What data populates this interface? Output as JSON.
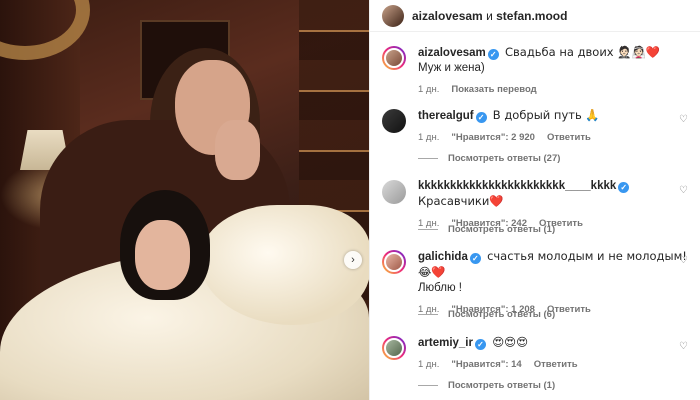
{
  "header": {
    "user1": "aizalovesam",
    "and": "и",
    "user2": "stefan.mood"
  },
  "caption": {
    "username": "aizalovesam",
    "text_line1": "Свадьба на двоих 🤵🏻👰🏻❤️",
    "text_line2": "Муж и жена)",
    "time": "1 дн.",
    "translate": "Показать перевод"
  },
  "comments": [
    {
      "username": "therealguf",
      "text": "В добрый путь 🙏",
      "time": "1 дн.",
      "likes": "\"Нравится\": 2 920",
      "reply": "Ответить",
      "view_replies": "Посмотреть ответы (27)"
    },
    {
      "username": "kkkkkkkkkkkkkkkkkkkkkkk____kkkk",
      "text": "Красавчики❤️",
      "time": "1 дн.",
      "likes": "\"Нравится\": 242",
      "reply": "Ответить",
      "view_replies": "Посмотреть ответы (1)"
    },
    {
      "username": "galichida",
      "text": "счастья молодым и не молодым! 😂❤️",
      "text_line2": "Люблю !",
      "time": "1 дн.",
      "likes": "\"Нравится\": 1 208",
      "reply": "Ответить",
      "view_replies": "Посмотреть ответы (6)"
    },
    {
      "username": "artemiy_ir",
      "text": "😍😍😍",
      "time": "1 дн.",
      "likes": "\"Нравится\": 14",
      "reply": "Ответить",
      "view_replies": "Посмотреть ответы (1)"
    }
  ],
  "icons": {
    "next": "chevron-right-icon",
    "heart": "heart-icon",
    "verified": "verified-badge-icon"
  },
  "colors": {
    "verified": "#3897f0",
    "muted": "#737373"
  }
}
